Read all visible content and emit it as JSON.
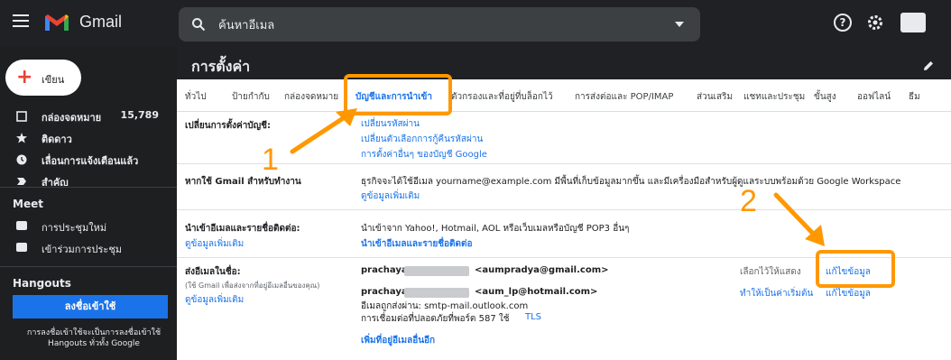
{
  "topbar": {
    "brand": "Gmail",
    "search_placeholder": "ค้นหาอีเมล",
    "help_glyph": "?"
  },
  "sidebar": {
    "compose_label": "เขียน",
    "items": [
      {
        "label": "กล่องจดหมาย",
        "count": "15,789"
      },
      {
        "label": "ติดดาว",
        "count": ""
      },
      {
        "label": "เลื่อนการแจ้งเตือนแล้ว",
        "count": ""
      },
      {
        "label": "สำคัญ",
        "count": ""
      }
    ],
    "meet_title": "Meet",
    "meet_items": [
      {
        "label": "การประชุมใหม่"
      },
      {
        "label": "เข้าร่วมการประชุม"
      }
    ],
    "hangouts_title": "Hangouts",
    "hangouts_button": "ลงชื่อเข้าใช้",
    "hangouts_note": "การลงชื่อเข้าใช้จะเป็นการลงชื่อเข้าใช้ Hangouts ทั่วทั้ง Google"
  },
  "settings": {
    "title": "การตั้งค่า",
    "tabs": [
      {
        "label": "ทั่วไป"
      },
      {
        "label": "ป้ายกำกับ"
      },
      {
        "label": "กล่องจดหมาย"
      },
      {
        "label": "บัญชีและการนำเข้า",
        "active": true
      },
      {
        "label": "ตัวกรองและที่อยู่ที่บล็อกไว้"
      },
      {
        "label": "การส่งต่อและ POP/IMAP"
      },
      {
        "label": "ส่วนเสริม"
      },
      {
        "label": "แชทและประชุม"
      },
      {
        "label": "ขั้นสูง"
      },
      {
        "label": "ออฟไลน์"
      },
      {
        "label": "ธีม"
      }
    ],
    "rows": {
      "change_account": {
        "label": "เปลี่ยนการตั้งค่าบัญชี:",
        "links": [
          "เปลี่ยนรหัสผ่าน",
          "เปลี่ยนตัวเลือกการกู้คืนรหัสผ่าน",
          "การตั้งค่าอื่นๆ ของบัญชี Google"
        ]
      },
      "work": {
        "label": "หากใช้ Gmail สำหรับทำงาน",
        "text": "ธุรกิจจะได้ใช้อีเมล yourname@example.com มีพื้นที่เก็บข้อมูลมากขึ้น และมีเครื่องมือสำหรับผู้ดูแลระบบพร้อมด้วย Google Workspace",
        "link": "ดูข้อมูลเพิ่มเติม"
      },
      "import": {
        "label": "นำเข้าอีเมลและรายชื่อติดต่อ:",
        "label_link": "ดูข้อมูลเพิ่มเติม",
        "text": "นำเข้าจาก Yahoo!, Hotmail, AOL หรือเว็บเมลหรือบัญชี POP3 อื่นๆ",
        "link": "นำเข้าอีเมลและรายชื่อติดต่อ"
      },
      "send_as": {
        "label": "ส่งอีเมลในชื่อ:",
        "sub": "(ใช้ Gmail เพื่อส่งจากที่อยู่อีเมลอื่นของคุณ)",
        "label_link": "ดูข้อมูลเพิ่มเติม",
        "acc1_name": "prachaya",
        "acc1_email": "<aumpradya@gmail.com>",
        "acc1_status": "เลือกไว้ให้แสดง",
        "acc1_edit": "แก้ไขข้อมูล",
        "acc2_name": "prachaya",
        "acc2_email": "<aum_lp@hotmail.com>",
        "acc2_line1": "อีเมลถูกส่งผ่าน: smtp-mail.outlook.com",
        "acc2_line2": "การเชื่อมต่อที่ปลอดภัยที่พอร์ต 587 ใช้",
        "acc2_tls": "TLS",
        "acc2_default": "ทำให้เป็นค่าเริ่มต้น",
        "acc2_edit": "แก้ไขข้อมูล",
        "add_link": "เพิ่มที่อยู่อีเมลอื่นอีก"
      }
    }
  },
  "annotations": {
    "step1": "1",
    "step2": "2",
    "color": "#ff9800"
  }
}
